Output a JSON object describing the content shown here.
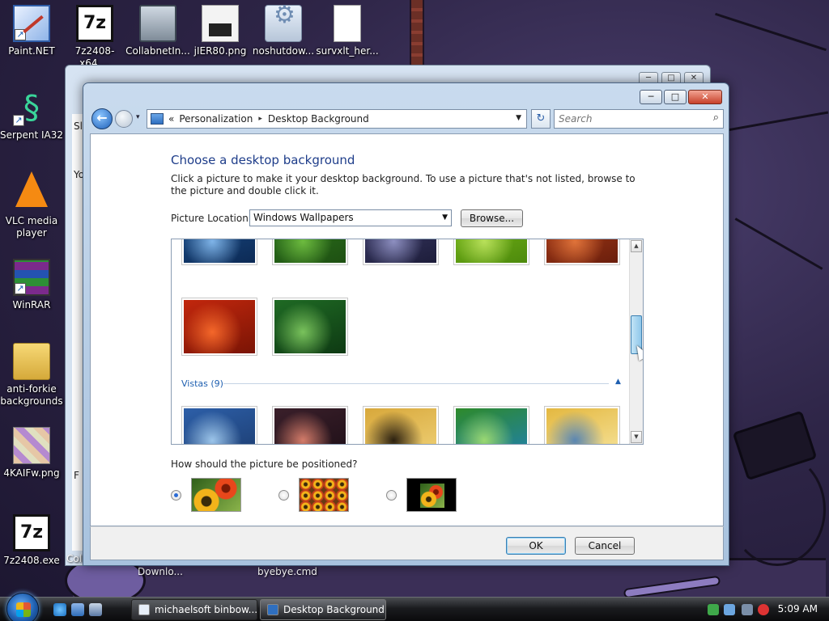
{
  "desktop": {
    "icons": [
      {
        "label": "Paint.NET"
      },
      {
        "label": "7z2408-x64...."
      },
      {
        "label": "CollabnetIn..."
      },
      {
        "label": "jIER80.png"
      },
      {
        "label": "noshutdow..."
      },
      {
        "label": "survxlt_her..."
      },
      {
        "label": "Serpent IA32"
      },
      {
        "label": "VLC media player"
      },
      {
        "label": "WinRAR"
      },
      {
        "label": "anti-forkie backgrounds"
      },
      {
        "label": "4KAIFw.png"
      },
      {
        "label": "7z2408.exe"
      }
    ],
    "partial_labels": [
      "Coll",
      "Downlo...",
      "byebye.cmd"
    ]
  },
  "background_window": {
    "fragments": [
      "Sl",
      "Yo",
      "F"
    ],
    "controls": [
      "─",
      "□",
      "✕"
    ]
  },
  "window": {
    "controls": {
      "minimize": "─",
      "maximize": "□",
      "close": "✕"
    },
    "nav": {
      "back": "←",
      "recent": "▾",
      "breadcrumb": [
        "Personalization",
        "Desktop Background"
      ],
      "breadcrumb_prefix": "«",
      "breadcrumb_sep": "▸",
      "address_dropdown": "▼",
      "refresh": "↻",
      "search_placeholder": "Search",
      "search_icon": "⌕"
    },
    "heading": "Choose a desktop background",
    "description": "Click a picture to make it your desktop background. To use a picture that's not listed, browse to the picture and double click it.",
    "picture_location_label": "Picture Location",
    "picture_location_value": "Windows Wallpapers",
    "picture_location_arrow": "▼",
    "browse_label": "Browse...",
    "gallery": {
      "group_label": "Vistas (9)",
      "group_toggle": "▲",
      "scroll_up": "▲",
      "scroll_down": "▼",
      "scroll_position": 0.45,
      "thumbnails": [
        {
          "name": "blue-wave",
          "colors": [
            "#1b4f8c",
            "#7fb4e8",
            "#0c2a55"
          ]
        },
        {
          "name": "green-leaves",
          "colors": [
            "#2f7a1f",
            "#6dbb3f",
            "#1e5012"
          ]
        },
        {
          "name": "pebbles",
          "colors": [
            "#3f3f6e",
            "#8d8fc0",
            "#1d1d3a"
          ]
        },
        {
          "name": "green-blade",
          "colors": [
            "#7cbc1a",
            "#b8e05a",
            "#4d8a0c"
          ]
        },
        {
          "name": "orange-fur",
          "colors": [
            "#b0401a",
            "#e0733a",
            "#6a1e0c"
          ]
        },
        {
          "name": "red-gerbera",
          "colors": [
            "#c2270d",
            "#f4672a",
            "#7a1405"
          ]
        },
        {
          "name": "bamboo",
          "colors": [
            "#1f6a24",
            "#79c25c",
            "#0e3a13"
          ]
        },
        {
          "name": "mountain-lake",
          "colors": [
            "#2d5fa8",
            "#9cc5ea",
            "#1b3b6e"
          ]
        },
        {
          "name": "dusk-sky",
          "colors": [
            "#3a1f2a",
            "#d47c6a",
            "#1c0e16"
          ]
        },
        {
          "name": "rocky-sunset",
          "colors": [
            "#d8a83b",
            "#2b2010",
            "#f0d37a"
          ]
        },
        {
          "name": "palm-leaf",
          "colors": [
            "#2e8a2a",
            "#9ad872",
            "#1f7fb3"
          ]
        },
        {
          "name": "golden-sunrise",
          "colors": [
            "#e4b840",
            "#5a86b2",
            "#f7e6a0"
          ]
        }
      ]
    },
    "position_label": "How should the picture be positioned?",
    "position_options": [
      {
        "name": "fit-to-screen",
        "selected": true
      },
      {
        "name": "tile",
        "selected": false
      },
      {
        "name": "center",
        "selected": false
      }
    ],
    "ok_label": "OK",
    "cancel_label": "Cancel"
  },
  "taskbar": {
    "tasks": [
      {
        "label": "michaelsoft binbow..."
      },
      {
        "label": "Desktop Background",
        "active": true
      }
    ],
    "clock": "5:09 AM"
  }
}
